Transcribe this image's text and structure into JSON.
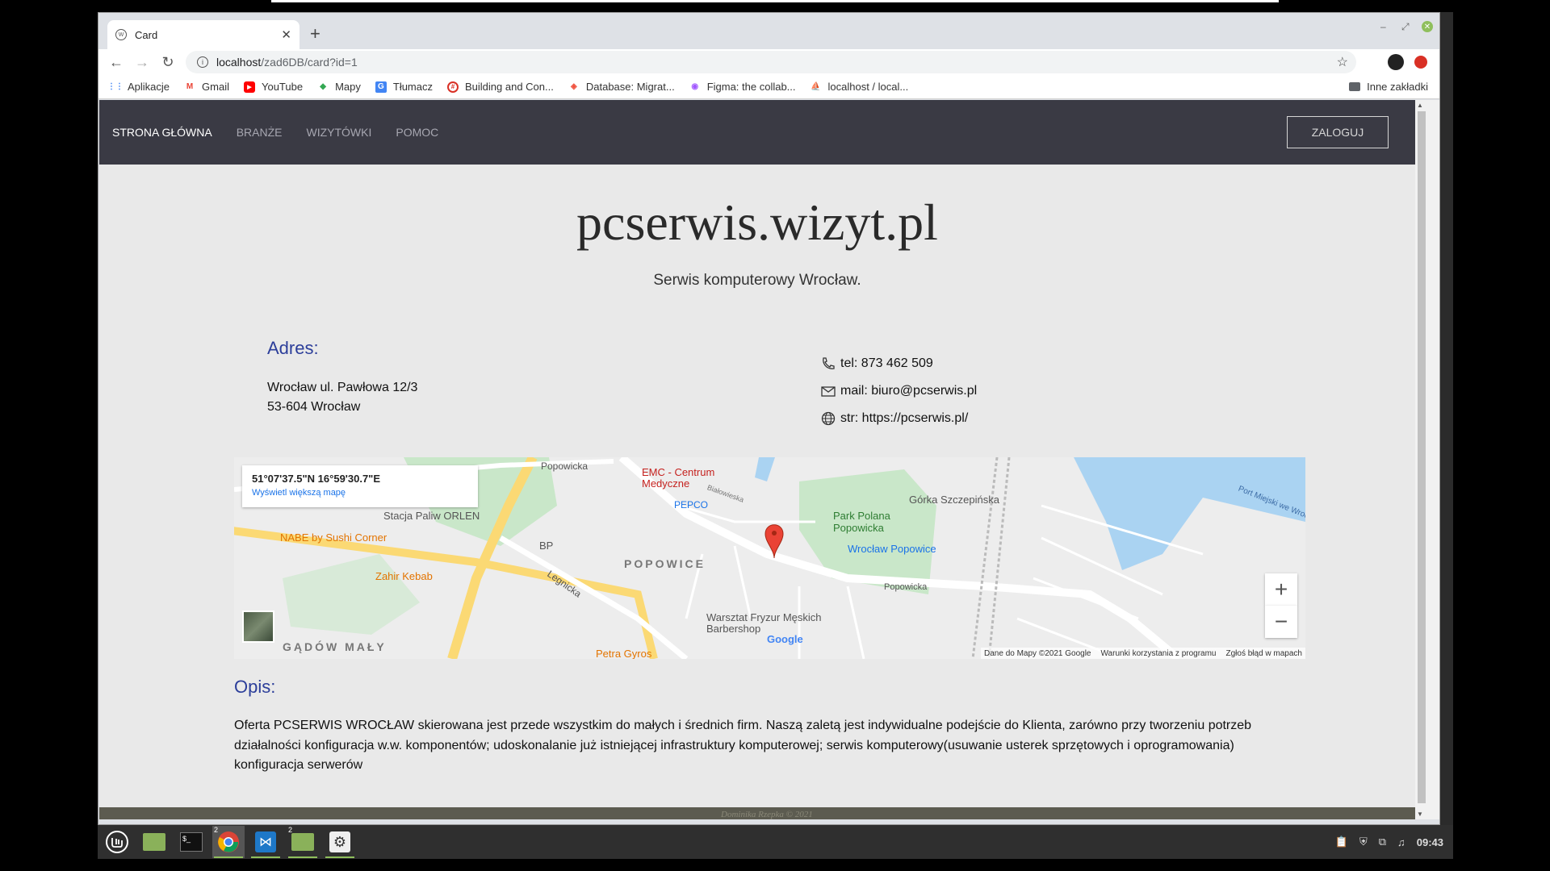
{
  "browser": {
    "tab_title": "Card",
    "url_host": "localhost",
    "url_path": "/zad6DB/card?id=1",
    "bookmarks": [
      {
        "label": "Aplikacje",
        "icon": "apps-grid-icon",
        "color": "#4285f4"
      },
      {
        "label": "Gmail",
        "icon": "gmail-icon",
        "color": "#ea4335"
      },
      {
        "label": "YouTube",
        "icon": "youtube-icon",
        "color": "#ff0000"
      },
      {
        "label": "Mapy",
        "icon": "maps-icon",
        "color": "#34a853"
      },
      {
        "label": "Tłumacz",
        "icon": "translate-icon",
        "color": "#4285f4"
      },
      {
        "label": "Building and Con...",
        "icon": "building-icon",
        "color": "#d93025"
      },
      {
        "label": "Database: Migrat...",
        "icon": "laravel-icon",
        "color": "#f05340"
      },
      {
        "label": "Figma: the collab...",
        "icon": "figma-icon",
        "color": "#a259ff"
      },
      {
        "label": "localhost / local...",
        "icon": "phpmyadmin-icon",
        "color": "#f29111"
      }
    ],
    "other_bookmarks": "Inne zakładki"
  },
  "site": {
    "nav": [
      "STRONA GŁÓWNA",
      "BRANŻE",
      "WIZYTÓWKI",
      "POMOC"
    ],
    "login": "ZALOGUJ",
    "title": "pcserwis.wizyt.pl",
    "subtitle": "Serwis komputerowy Wrocław.",
    "address_heading": "Adres:",
    "address_line1": "Wrocław ul. Pawłowa 12/3",
    "address_line2": "53-604 Wrocław",
    "phone": "tel: 873 462 509",
    "mail": "mail: biuro@pcserwis.pl",
    "www": "str: https://pcserwis.pl/",
    "description_heading": "Opis:",
    "description": "Oferta PCSERWIS WROCŁAW skierowana jest przede wszystkim do małych i średnich firm. Naszą zaletą jest indywidualne podejście do Klienta, zarówno przy tworzeniu potrzeb działalności konfiguracja w.w. komponentów; udoskonalanie już istniejącej infrastruktury komputerowej; serwis komputerowy(usuwanie usterek sprzętowych i oprogramowania) konfiguracja serwerów",
    "footer": "Dominika Rzepka © 2021"
  },
  "map": {
    "coords": "51°07'37.5\"N 16°59'30.7\"E",
    "bigger_map_link": "Wyświetl większą mapę",
    "labels": [
      "Popowicka",
      "EMC - Centrum Medyczne",
      "PEPCO",
      "Górka Szczepińska",
      "Park Polana Popowicka",
      "Wrocław Popowice",
      "Stacja Paliw ORLEN",
      "NABE by Sushi Corner",
      "BP",
      "POPOWICE",
      "Zahir Kebab",
      "Legnicka",
      "Warsztat Fryzur Męskich Barbershop",
      "GĄDÓW MAŁY",
      "Petra Gyros",
      "Port Miejski we Wrocławiu",
      "Białowieska",
      "Popowicka"
    ],
    "attrib_data": "Dane do Mapy ©2021 Google",
    "attrib_terms": "Warunki korzystania z programu",
    "attrib_report": "Zgłoś błąd w mapach",
    "zoom_in": "+",
    "zoom_out": "−",
    "google": "Google"
  },
  "taskbar": {
    "clock": "09:43",
    "badge_chrome": "2",
    "badge_files": "2"
  }
}
